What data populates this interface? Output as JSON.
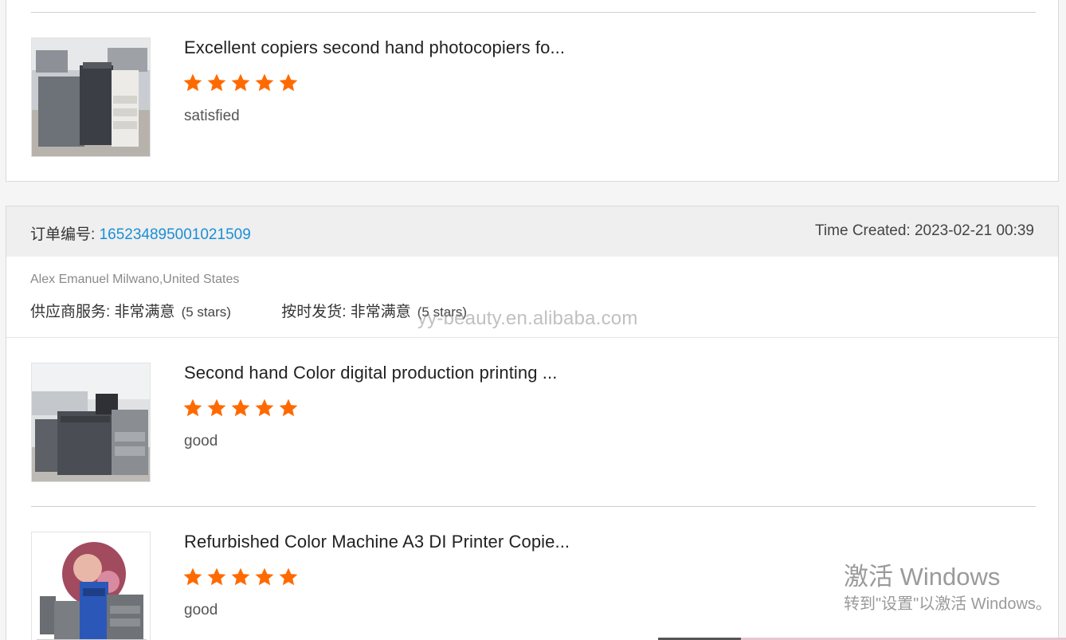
{
  "items_top": [
    {
      "title": "Excellent copiers second hand photocopiers fo...",
      "rating": 5,
      "comment": "satisfied"
    }
  ],
  "order": {
    "label": "订单编号: ",
    "number": "165234895001021509",
    "time_created": "Time Created: 2023-02-21 00:39",
    "buyer": "Alex Emanuel Milwano,United States",
    "supplier_service_label": "供应商服务: 非常满意",
    "supplier_service_stars": "(5 stars)",
    "on_time_shipping_label": "按时发货: 非常满意",
    "on_time_shipping_stars": "(5 stars)",
    "items": [
      {
        "title": "Second hand Color digital production printing ...",
        "rating": 5,
        "comment": "good"
      },
      {
        "title": "Refurbished Color Machine A3 DI Printer Copie...",
        "rating": 5,
        "comment": "good"
      }
    ]
  },
  "watermark": "yy-beauty.en.alibaba.com",
  "windows_activation": {
    "title": "激活 Windows",
    "subtitle": "转到\"设置\"以激活 Windows。"
  },
  "colors": {
    "star": "#ff6a00",
    "order_number": "#1a8fd6",
    "header_bg": "#efefef"
  }
}
